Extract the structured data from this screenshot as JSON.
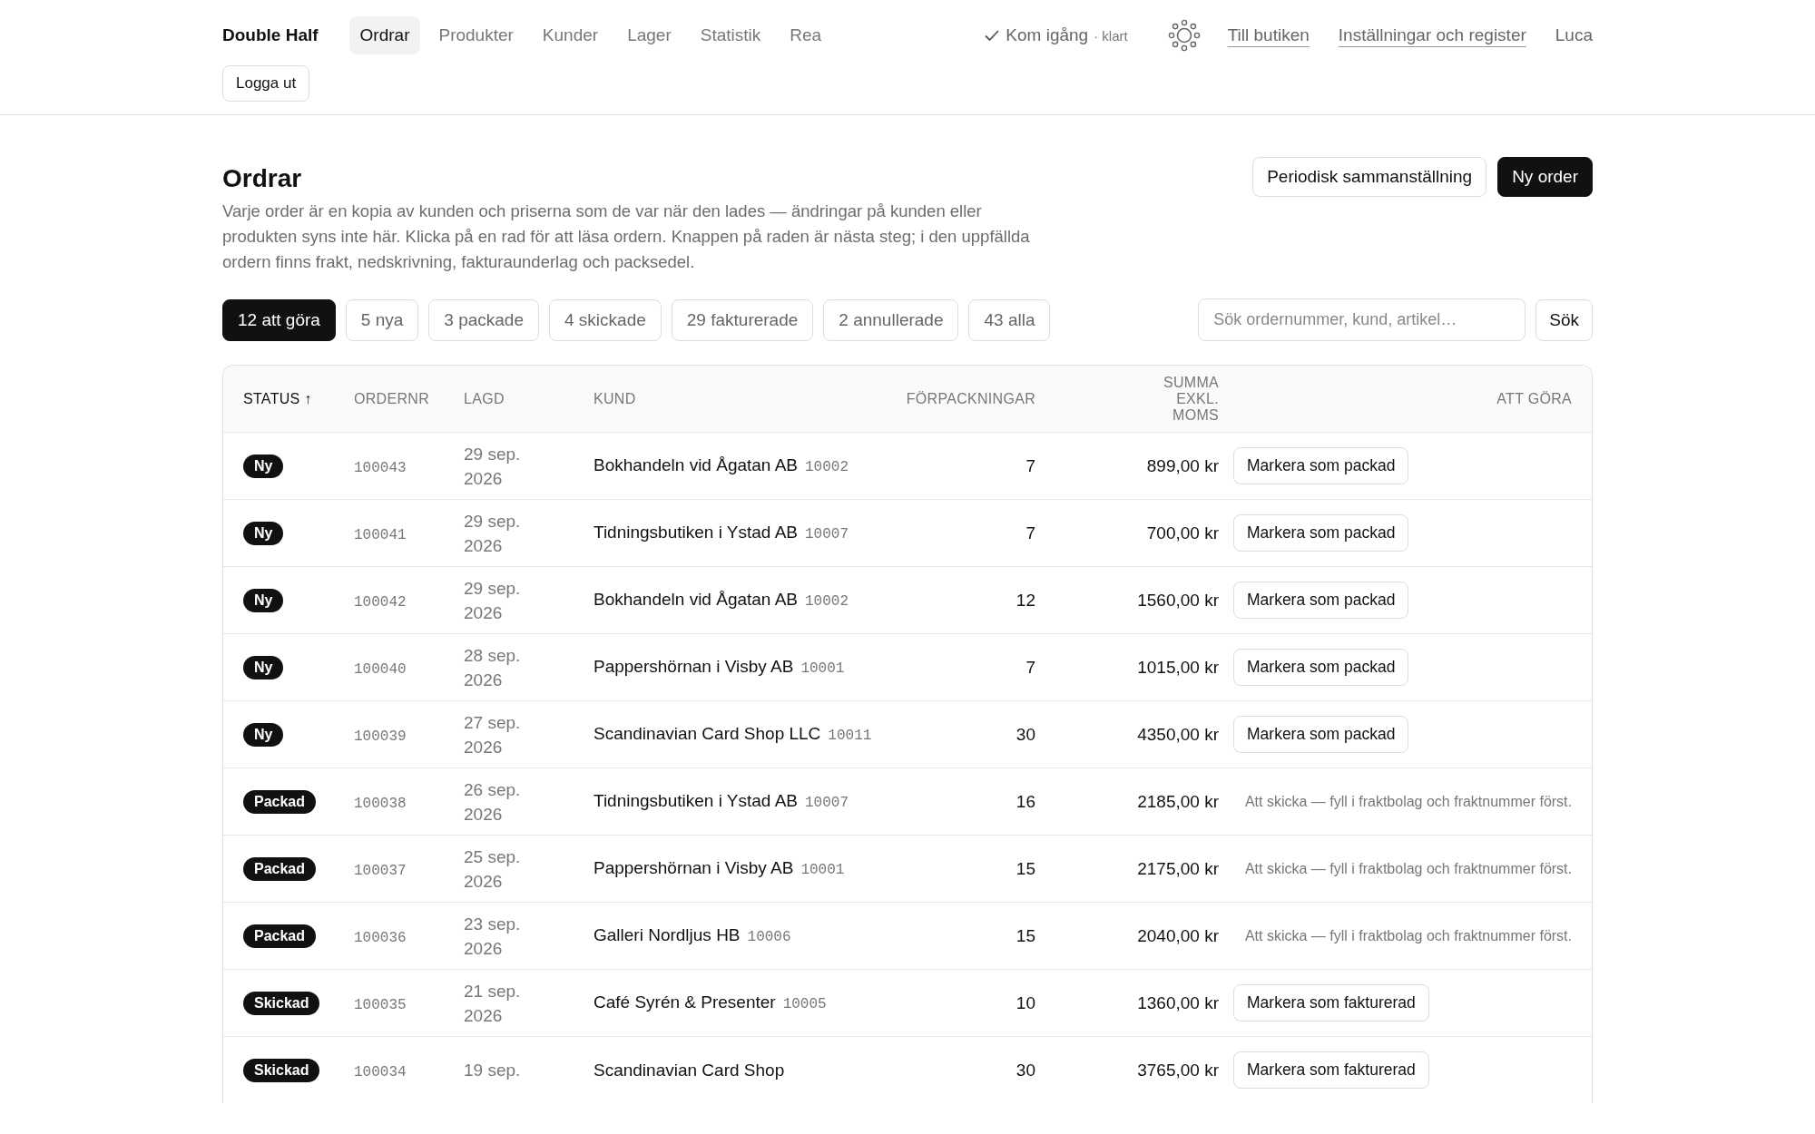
{
  "brand": "Double Half",
  "nav": [
    {
      "label": "Ordrar",
      "selected": true
    },
    {
      "label": "Produkter",
      "selected": false
    },
    {
      "label": "Kunder",
      "selected": false
    },
    {
      "label": "Lager",
      "selected": false
    },
    {
      "label": "Statistik",
      "selected": false
    },
    {
      "label": "Rea",
      "selected": false
    }
  ],
  "onboarding": {
    "label": "Kom igång",
    "status": "· klart",
    "done": true
  },
  "links": [
    "Till butiken",
    "Inställningar och register"
  ],
  "user": "Luca",
  "logout": "Logga ut",
  "page": {
    "title": "Ordrar",
    "description": "Varje order är en kopia av kunden och priserna som de var när den lades — ändringar på kunden eller produkten syns inte här. Klicka på en rad för att läsa ordern. Knappen på raden är nästa steg; i den uppfällda ordern finns frakt, nedskrivning, fakturaunderlag och packsedel.",
    "actions": [
      {
        "label": "Periodisk sammanställning",
        "primary": false
      },
      {
        "label": "Ny order",
        "primary": true
      }
    ]
  },
  "filters": [
    {
      "label": "12 att göra",
      "selected": true
    },
    {
      "label": "5 nya",
      "selected": false
    },
    {
      "label": "3 packade",
      "selected": false
    },
    {
      "label": "4 skickade",
      "selected": false
    },
    {
      "label": "29 fakturerade",
      "selected": false
    },
    {
      "label": "2 annullerade",
      "selected": false
    },
    {
      "label": "43 alla",
      "selected": false
    }
  ],
  "search": {
    "placeholder": "Sök ordernummer, kund, artikel…",
    "button": "Sök"
  },
  "table": {
    "columns": [
      {
        "label": "STATUS ↑",
        "sorted": true
      },
      {
        "label": "ORDERNR",
        "sorted": false
      },
      {
        "label": "LAGD",
        "sorted": false
      },
      {
        "label": "KUND",
        "sorted": false
      },
      {
        "label": "FÖRPACKNINGAR",
        "sorted": false
      },
      {
        "label": "SUMMA EXKL. MOMS",
        "sorted": false
      },
      {
        "label": "ATT GÖRA",
        "sorted": false
      }
    ],
    "rows": [
      {
        "status": "Ny",
        "order_no": "100043",
        "date": "29 sep. 2026",
        "customer": "Bokhandeln vid Ågatan AB",
        "customer_no": "10002",
        "packages": "7",
        "total": "899,00 kr",
        "todo": {
          "kind": "button",
          "text": "Markera som packad"
        }
      },
      {
        "status": "Ny",
        "order_no": "100041",
        "date": "29 sep. 2026",
        "customer": "Tidningsbutiken i Ystad AB",
        "customer_no": "10007",
        "packages": "7",
        "total": "700,00 kr",
        "todo": {
          "kind": "button",
          "text": "Markera som packad"
        }
      },
      {
        "status": "Ny",
        "order_no": "100042",
        "date": "29 sep. 2026",
        "customer": "Bokhandeln vid Ågatan AB",
        "customer_no": "10002",
        "packages": "12",
        "total": "1560,00 kr",
        "todo": {
          "kind": "button",
          "text": "Markera som packad"
        }
      },
      {
        "status": "Ny",
        "order_no": "100040",
        "date": "28 sep. 2026",
        "customer": "Pappershörnan i Visby AB",
        "customer_no": "10001",
        "packages": "7",
        "total": "1015,00 kr",
        "todo": {
          "kind": "button",
          "text": "Markera som packad"
        }
      },
      {
        "status": "Ny",
        "order_no": "100039",
        "date": "27 sep. 2026",
        "customer": "Scandinavian Card Shop LLC",
        "customer_no": "10011",
        "packages": "30",
        "total": "4350,00 kr",
        "todo": {
          "kind": "button",
          "text": "Markera som packad"
        }
      },
      {
        "status": "Packad",
        "order_no": "100038",
        "date": "26 sep. 2026",
        "customer": "Tidningsbutiken i Ystad AB",
        "customer_no": "10007",
        "packages": "16",
        "total": "2185,00 kr",
        "todo": {
          "kind": "note",
          "text": "Att skicka — fyll i fraktbolag och fraktnummer först."
        }
      },
      {
        "status": "Packad",
        "order_no": "100037",
        "date": "25 sep. 2026",
        "customer": "Pappershörnan i Visby AB",
        "customer_no": "10001",
        "packages": "15",
        "total": "2175,00 kr",
        "todo": {
          "kind": "note",
          "text": "Att skicka — fyll i fraktbolag och fraktnummer först."
        }
      },
      {
        "status": "Packad",
        "order_no": "100036",
        "date": "23 sep. 2026",
        "customer": "Galleri Nordljus HB",
        "customer_no": "10006",
        "packages": "15",
        "total": "2040,00 kr",
        "todo": {
          "kind": "note",
          "text": "Att skicka — fyll i fraktbolag och fraktnummer först."
        }
      },
      {
        "status": "Skickad",
        "order_no": "100035",
        "date": "21 sep. 2026",
        "customer": "Café Syrén & Presenter",
        "customer_no": "10005",
        "packages": "10",
        "total": "1360,00 kr",
        "todo": {
          "kind": "button",
          "text": "Markera som fakturerad"
        }
      },
      {
        "status": "Skickad",
        "order_no": "100034",
        "date": "19 sep.",
        "customer": "Scandinavian Card Shop",
        "packages": "30",
        "total": "3765,00 kr",
        "todo": {
          "kind": "button",
          "text": "Markera som fakturerad"
        }
      }
    ]
  }
}
